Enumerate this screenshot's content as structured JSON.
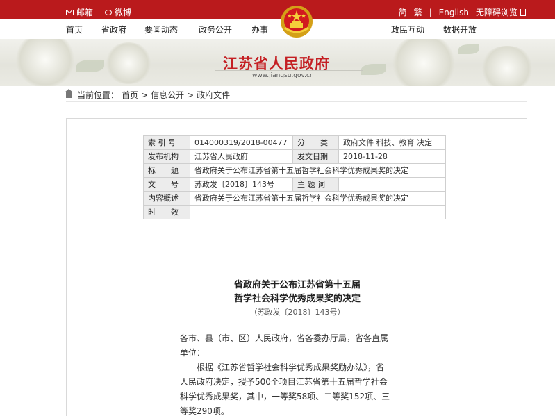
{
  "topbar": {
    "mail_label": "邮箱",
    "weibo_label": "微博",
    "simplified": "简",
    "traditional": "繁",
    "sep": "|",
    "english": "English",
    "accessible": "无障碍浏览"
  },
  "nav": {
    "items": [
      "首页",
      "省政府",
      "要闻动态",
      "政务公开",
      "办事",
      "政民互动",
      "数据开放"
    ]
  },
  "banner": {
    "title": "江苏省人民政府",
    "url": "www.jiangsu.gov.cn"
  },
  "breadcrumb": {
    "prefix": "当前位置：",
    "items": [
      "首页",
      "信息公开",
      "政府文件"
    ],
    "sep": ">"
  },
  "meta": {
    "index_label": "索 引 号",
    "index_value": "014000319/2018-00477",
    "category_label": "分　　类",
    "category_value": "政府文件 科技、教育 决定",
    "issuer_label": "发布机构",
    "issuer_value": "江苏省人民政府",
    "date_label": "发文日期",
    "date_value": "2018-11-28",
    "title_label": "标　　题",
    "title_value": "省政府关于公布江苏省第十五届哲学社会科学优秀成果奖的决定",
    "docno_label": "文　　号",
    "docno_value": "苏政发〔2018〕143号",
    "subject_label": "主 题 词",
    "subject_value": "",
    "summary_label": "内容概述",
    "summary_value": "省政府关于公布江苏省第十五届哲学社会科学优秀成果奖的决定",
    "validity_label": "时　　效",
    "validity_value": ""
  },
  "doc": {
    "title_line1": "省政府关于公布江苏省第十五届",
    "title_line2": "哲学社会科学优秀成果奖的决定",
    "number": "（苏政发〔2018〕143号）",
    "addressee_line1": "各市、县（市、区）人民政府，省各委办厅局，省各直属",
    "addressee_line2": "单位：",
    "para_line1": "　　根据《江苏省哲学社会科学优秀成果奖励办法》，省",
    "para_line2": "人民政府决定，授予500个项目江苏省第十五届哲学社会",
    "para_line3": "科学优秀成果奖，其中，一等奖58项、二等奖152项、三",
    "para_line4": "等奖290项。"
  },
  "colors": {
    "brand_red": "#ba1a1c",
    "title_red": "#c41f23"
  }
}
